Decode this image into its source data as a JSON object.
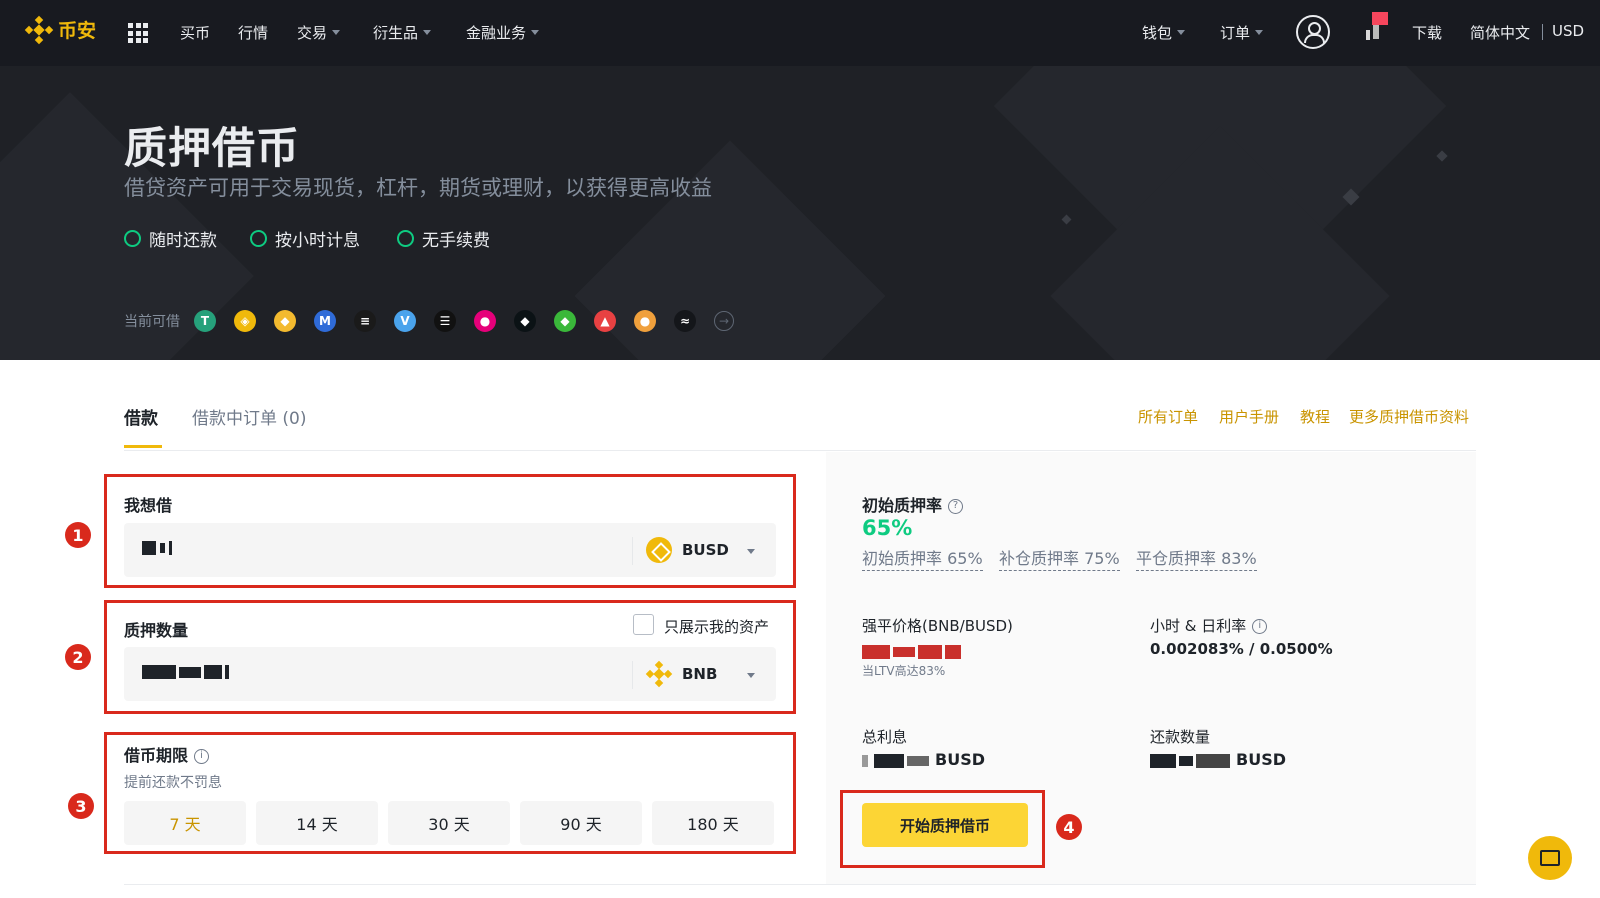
{
  "nav": {
    "logo": "币安",
    "items": [
      {
        "label": "买币",
        "caret": false
      },
      {
        "label": "行情",
        "caret": false
      },
      {
        "label": "交易",
        "caret": true
      },
      {
        "label": "衍生品",
        "caret": true
      },
      {
        "label": "金融业务",
        "caret": true
      }
    ],
    "right": {
      "wallet": "钱包",
      "orders": "订单",
      "download": "下载",
      "language": "简体中文",
      "currency": "USD"
    }
  },
  "hero": {
    "title": "质押借币",
    "subtitle": "借贷资产可用于交易现货，杠杆，期货或理财，以获得更高收益",
    "features": [
      "随时还款",
      "按小时计息",
      "无手续费"
    ],
    "borrowable_label": "当前可借",
    "coins": [
      {
        "name": "tether-coin",
        "glyph": "T",
        "color": "#26a17b"
      },
      {
        "name": "busd-coin",
        "glyph": "◈",
        "color": "#f0b90b"
      },
      {
        "name": "bnb-coin",
        "glyph": "◆",
        "color": "#f3ba2f"
      },
      {
        "name": "mana-coin",
        "glyph": "M",
        "color": "#2f6bd8"
      },
      {
        "name": "sol-coin",
        "glyph": "≡",
        "color": "#1a1a1a"
      },
      {
        "name": "vet-coin",
        "glyph": "V",
        "color": "#4aa3ec"
      },
      {
        "name": "ens-coin",
        "glyph": "☰",
        "color": "#111111"
      },
      {
        "name": "dot-coin",
        "glyph": "●",
        "color": "#e6007a"
      },
      {
        "name": "bnt-coin",
        "glyph": "◆",
        "color": "#0b1215"
      },
      {
        "name": "etc-coin",
        "glyph": "◆",
        "color": "#3ab83a"
      },
      {
        "name": "avax-coin",
        "glyph": "▲",
        "color": "#e84142"
      },
      {
        "name": "shib-coin",
        "glyph": "●",
        "color": "#f0a03c"
      },
      {
        "name": "xlm-coin",
        "glyph": "≈",
        "color": "#14161a"
      }
    ],
    "more_icon": "→"
  },
  "tabs": {
    "borrow": "借款",
    "orders": "借款中订单 (0)"
  },
  "top_links": [
    "所有订单",
    "用户手册",
    "教程",
    "更多质押借币资料"
  ],
  "form": {
    "steps": [
      "1",
      "2",
      "3",
      "4"
    ],
    "borrow": {
      "label": "我想借",
      "asset": "BUSD"
    },
    "collateral": {
      "label": "质押数量",
      "only_my_assets": "只展示我的资产",
      "asset": "BNB"
    },
    "term": {
      "label": "借币期限",
      "hint": "提前还款不罚息",
      "options": [
        "7 天",
        "14 天",
        "30 天",
        "90 天",
        "180 天"
      ],
      "selected": "7 天"
    }
  },
  "summary": {
    "initial_ltv_label": "初始质押率",
    "initial_ltv_value": "65%",
    "ltv_lines": [
      "初始质押率 65%",
      "补仓质押率 75%",
      "平仓质押率 83%"
    ],
    "liq_price_label": "强平价格(BNB/BUSD)",
    "liq_hint": "当LTV高达83%",
    "rate_label": "小时 & 日利率",
    "rate_value": "0.002083% / 0.0500%",
    "total_interest_label": "总利息",
    "total_interest_unit": "BUSD",
    "repay_label": "还款数量",
    "repay_unit": "BUSD",
    "submit": "开始质押借币"
  },
  "colors": {
    "brand": "#f0b90b",
    "highlight_box": "#d9291c",
    "positive": "#0ecb81"
  }
}
